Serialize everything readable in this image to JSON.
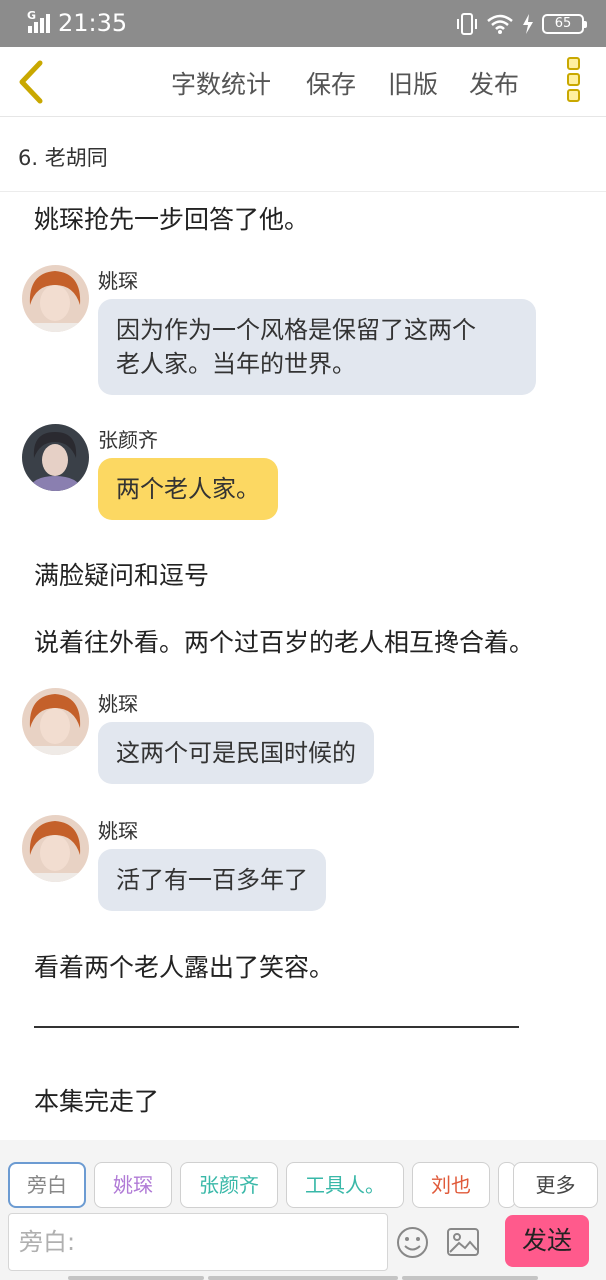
{
  "status_bar": {
    "time": "21:35",
    "network": "G",
    "battery": "65"
  },
  "toolbar": {
    "items": [
      "字数统计",
      "保存",
      "旧版",
      "发布"
    ]
  },
  "chapter": {
    "title": "6. 老胡同"
  },
  "story": {
    "narration_1": "姚琛抢先一步回答了他。",
    "msg_1": {
      "name": "姚琛",
      "lines": [
        "因为作为一个风格是保留了这两个",
        "老人家。当年的世界。"
      ]
    },
    "msg_2": {
      "name": "张颜齐",
      "text": "两个老人家。"
    },
    "narration_2": "满脸疑问和逗号",
    "narration_3": "说着往外看。两个过百岁的老人相互搀合着。",
    "msg_3": {
      "name": "姚琛",
      "text": "这两个可是民国时候的"
    },
    "msg_4": {
      "name": "姚琛",
      "text": "活了有一百多年了"
    },
    "narration_4": "看着两个老人露出了笑容。",
    "narration_5": "本集完走了"
  },
  "roles": [
    {
      "label": "旁白",
      "color": "#888888"
    },
    {
      "label": "姚琛",
      "color": "#b07ad6"
    },
    {
      "label": "张颜齐",
      "color": "#39b8a8"
    },
    {
      "label": "工具人。",
      "color": "#39b8a8"
    },
    {
      "label": "刘也",
      "color": "#e05a3a"
    }
  ],
  "more_label": "更多",
  "composer": {
    "placeholder": "旁白:",
    "send_label": "发送"
  }
}
